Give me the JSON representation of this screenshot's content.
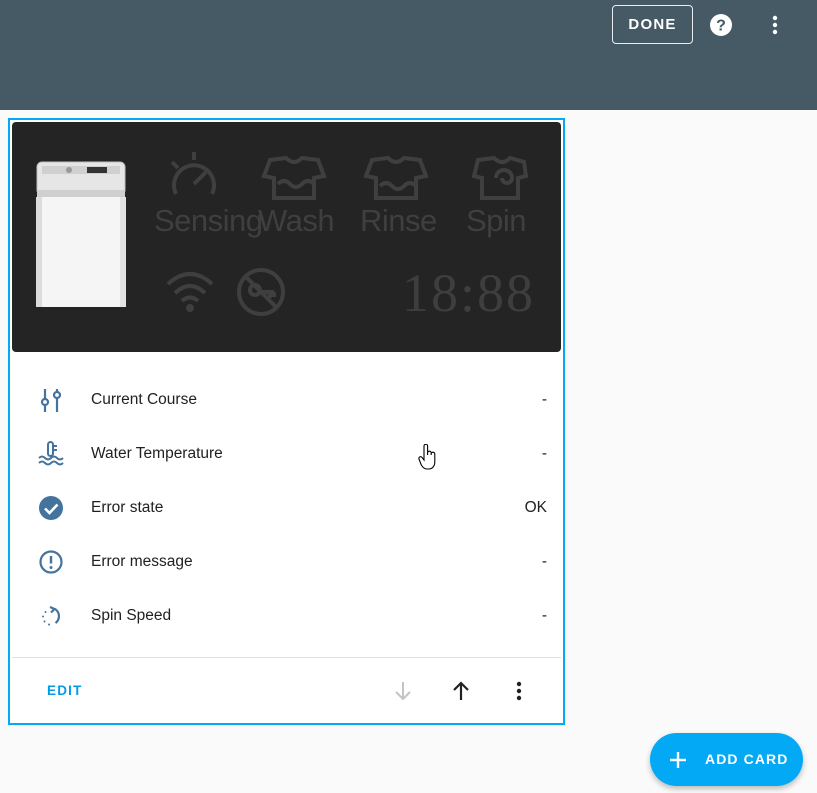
{
  "header": {
    "done_label": "DONE",
    "help_icon": "help-circle-icon",
    "more_icon": "dots-vertical-icon"
  },
  "washer_panel": {
    "stages": [
      "Sensing",
      "Wash",
      "Rinse",
      "Spin"
    ],
    "time": "18:88",
    "icons": [
      "washer-image",
      "sensing-icon",
      "wash-icon",
      "rinse-icon",
      "spin-icon",
      "wifi-icon",
      "child-lock-icon"
    ]
  },
  "entities": [
    {
      "name": "Current Course",
      "state": "-",
      "icon": "tune-vertical-icon"
    },
    {
      "name": "Water Temperature",
      "state": "-",
      "icon": "thermometer-water-icon"
    },
    {
      "name": "Error state",
      "state": "OK",
      "icon": "check-circle-icon"
    },
    {
      "name": "Error message",
      "state": "-",
      "icon": "alert-circle-outline-icon"
    },
    {
      "name": "Spin Speed",
      "state": "-",
      "icon": "rotate-dotted-icon"
    }
  ],
  "card_footer": {
    "edit_label": "EDIT",
    "move_down_icon": "arrow-down-icon",
    "move_up_icon": "arrow-up-icon",
    "more_icon": "dots-vertical-icon"
  },
  "fab": {
    "label": "ADD CARD",
    "icon": "plus-icon"
  },
  "colors": {
    "header_bg": "#455a64",
    "accent": "#03a9f4",
    "icon": "#44739e",
    "panel_bg": "#242424",
    "panel_inactive": "#3f3f3f"
  }
}
